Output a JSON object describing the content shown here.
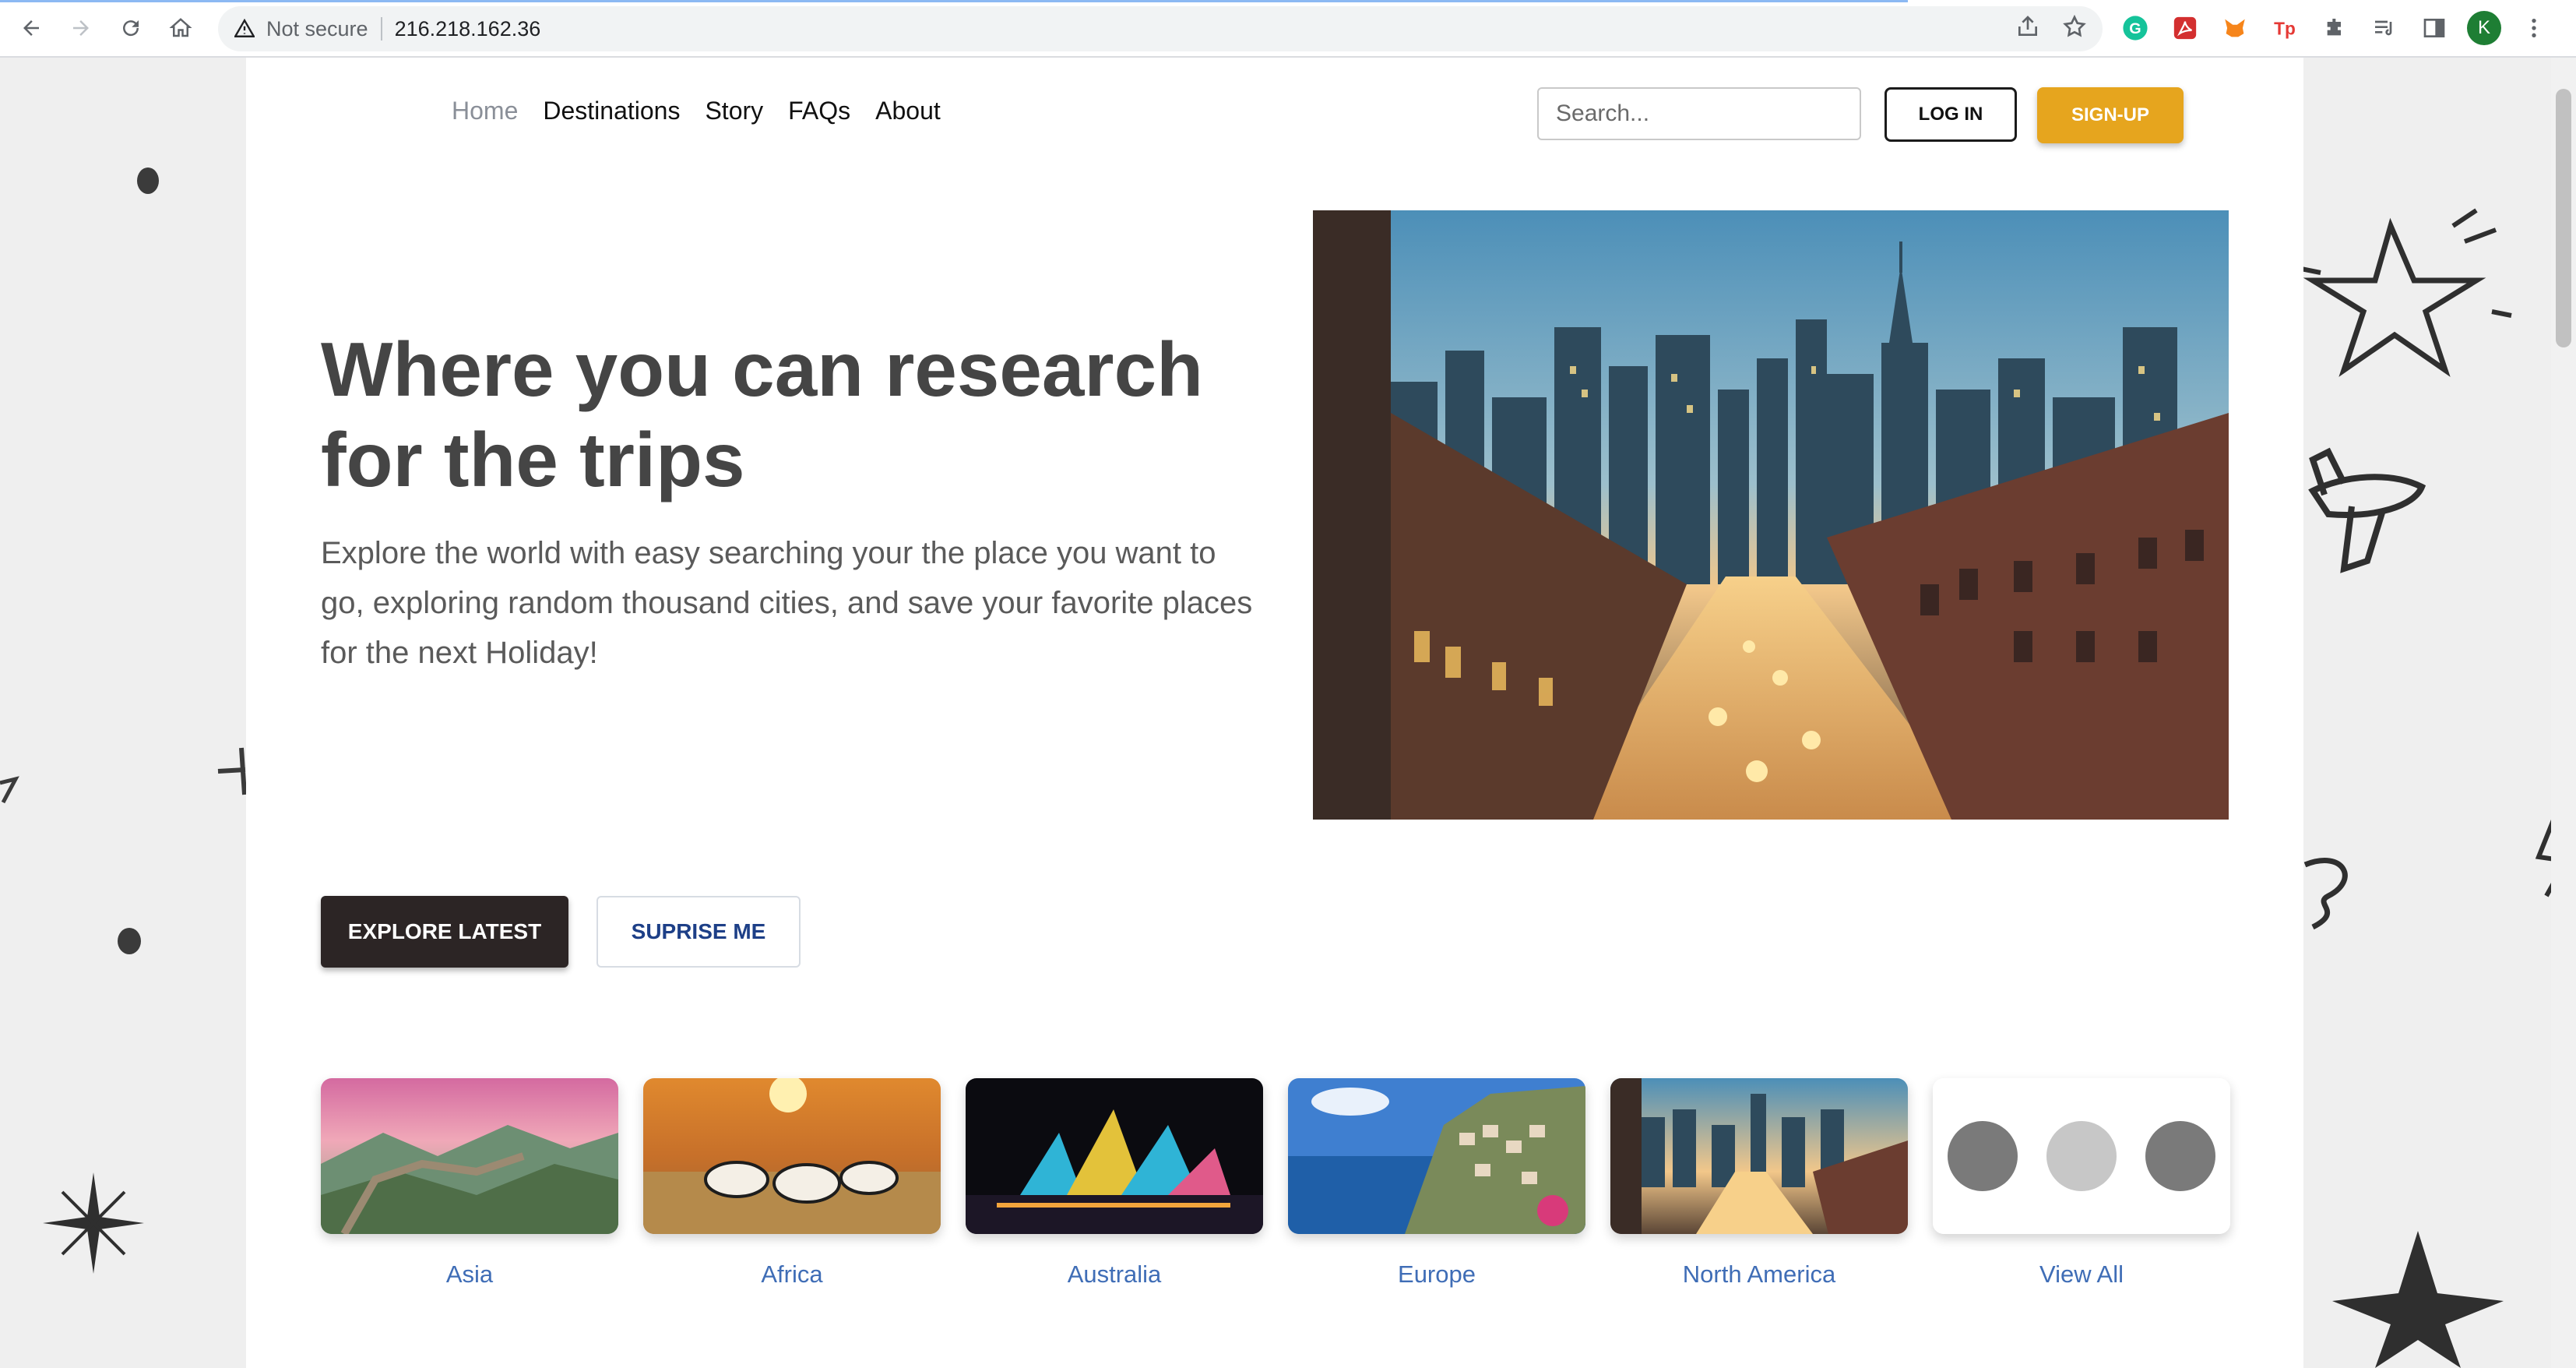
{
  "browser": {
    "security_label": "Not secure",
    "url": "216.218.162.36",
    "avatar_letter": "K"
  },
  "nav": {
    "items": [
      {
        "label": "Home",
        "active": true
      },
      {
        "label": "Destinations",
        "active": false
      },
      {
        "label": "Story",
        "active": false
      },
      {
        "label": "FAQs",
        "active": false
      },
      {
        "label": "About",
        "active": false
      }
    ],
    "search_placeholder": "Search...",
    "login_label": "LOG IN",
    "signup_label": "SIGN-UP"
  },
  "hero": {
    "title_line1": "Where you can research",
    "title_line2": "for the trips",
    "subtitle": "Explore the world with easy searching your the place you want to go, exploring random thousand cities, and save your favorite places for the next Holiday!",
    "explore_label": "EXPLORE LATEST",
    "surprise_label": "SUPRISE ME"
  },
  "regions": [
    {
      "label": "Asia"
    },
    {
      "label": "Africa"
    },
    {
      "label": "Australia"
    },
    {
      "label": "Europe"
    },
    {
      "label": "North America"
    },
    {
      "label": "View All"
    }
  ],
  "colors": {
    "accent": "#e6a51e",
    "link": "#3f6db6",
    "dark_button": "#2c2525",
    "heading": "#454545"
  }
}
